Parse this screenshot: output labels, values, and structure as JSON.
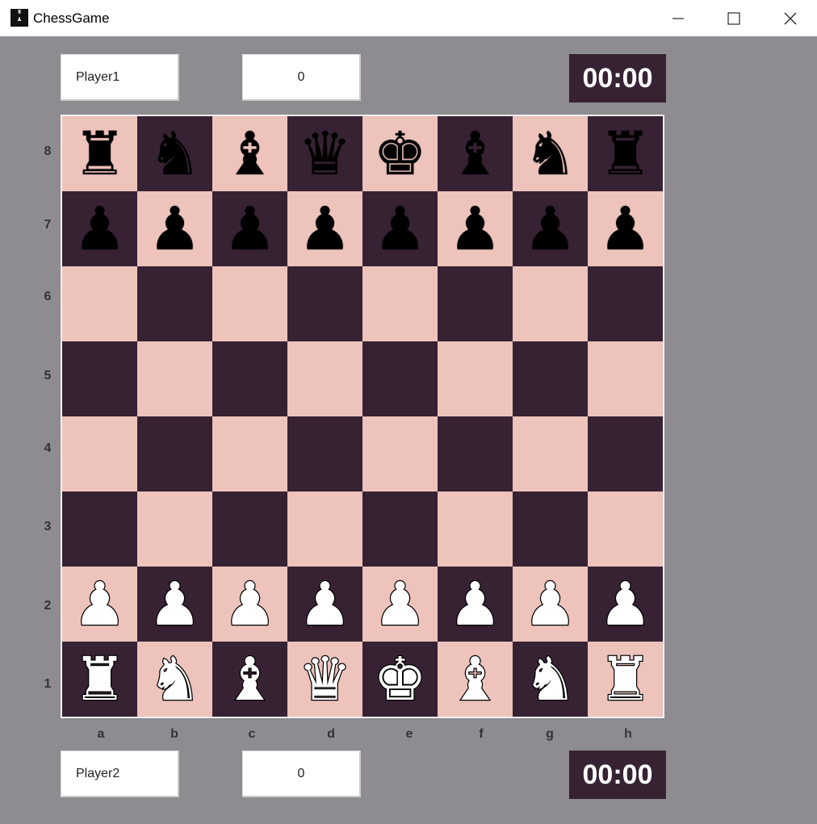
{
  "window": {
    "title": "ChessGame",
    "icon": "chess-app-icon",
    "controls": [
      "minimize-icon",
      "maximize-icon",
      "close-icon"
    ]
  },
  "top_player": {
    "name": "Player1",
    "score": "0",
    "clock": "00:00"
  },
  "bottom_player": {
    "name": "Player2",
    "score": "0",
    "clock": "00:00"
  },
  "board": {
    "ranks": [
      "8",
      "7",
      "6",
      "5",
      "4",
      "3",
      "2",
      "1"
    ],
    "files": [
      "a",
      "b",
      "c",
      "d",
      "e",
      "f",
      "g",
      "h"
    ],
    "colors": {
      "light": "#edc3bb",
      "dark": "#372234",
      "background": "#8e8b91"
    },
    "position": [
      [
        "br",
        "bn",
        "bb",
        "bq",
        "bk",
        "bb",
        "bn",
        "br"
      ],
      [
        "bp",
        "bp",
        "bp",
        "bp",
        "bp",
        "bp",
        "bp",
        "bp"
      ],
      [
        "",
        "",
        "",
        "",
        "",
        "",
        "",
        ""
      ],
      [
        "",
        "",
        "",
        "",
        "",
        "",
        "",
        ""
      ],
      [
        "",
        "",
        "",
        "",
        "",
        "",
        "",
        ""
      ],
      [
        "",
        "",
        "",
        "",
        "",
        "",
        "",
        ""
      ],
      [
        "wp",
        "wp",
        "wp",
        "wp",
        "wp",
        "wp",
        "wp",
        "wp"
      ],
      [
        "wr",
        "wn",
        "wb",
        "wq",
        "wk",
        "wb",
        "wn",
        "wr"
      ]
    ]
  }
}
